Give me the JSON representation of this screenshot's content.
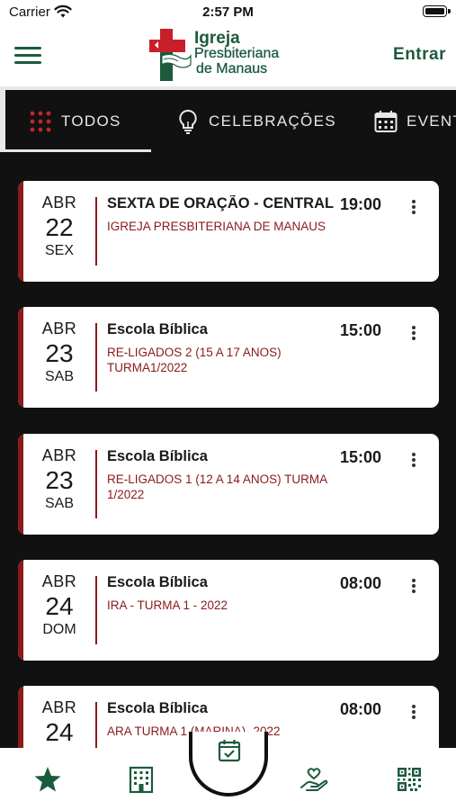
{
  "status_bar": {
    "carrier": "Carrier",
    "time": "2:57 PM"
  },
  "header": {
    "logo_line1": "Igreja",
    "logo_line2": "Presbiteriana",
    "logo_line3": "de Manaus",
    "login_label": "Entrar"
  },
  "tabs": [
    {
      "label": "TODOS",
      "icon": "grid-dots-icon",
      "active": true
    },
    {
      "label": "CELEBRAÇÕES",
      "icon": "lightbulb-icon",
      "active": false
    },
    {
      "label": "EVENTOS",
      "icon": "calendar-icon",
      "active": false
    }
  ],
  "events": [
    {
      "month": "ABR",
      "day": "22",
      "weekday": "SEX",
      "title": "SEXTA DE ORAÇÃO - CENTRAL",
      "subtitle": "IGREJA PRESBITERIANA DE MANAUS",
      "time": "19:00"
    },
    {
      "month": "ABR",
      "day": "23",
      "weekday": "SAB",
      "title": "Escola Bíblica",
      "subtitle": "RE-LIGADOS 2 (15 A 17 ANOS) TURMA1/2022",
      "time": "15:00"
    },
    {
      "month": "ABR",
      "day": "23",
      "weekday": "SAB",
      "title": "Escola Bíblica",
      "subtitle": "RE-LIGADOS 1 (12 A 14 ANOS) TURMA 1/2022",
      "time": "15:00"
    },
    {
      "month": "ABR",
      "day": "24",
      "weekday": "DOM",
      "title": "Escola Bíblica",
      "subtitle": "IRA - TURMA 1 - 2022",
      "time": "08:00"
    },
    {
      "month": "ABR",
      "day": "24",
      "weekday": "",
      "title": "Escola Bíblica",
      "subtitle": "ARA TURMA 1 (MARINA)- 2022",
      "time": "08:00"
    }
  ],
  "bottom_nav": [
    {
      "icon": "star-icon"
    },
    {
      "icon": "building-icon"
    },
    {
      "icon": "calendar-check-icon",
      "active": true
    },
    {
      "icon": "hand-heart-icon"
    },
    {
      "icon": "qr-code-icon"
    }
  ],
  "colors": {
    "brand_green": "#1c5a3e",
    "accent_red": "#8b1a1a",
    "background": "#111111"
  }
}
